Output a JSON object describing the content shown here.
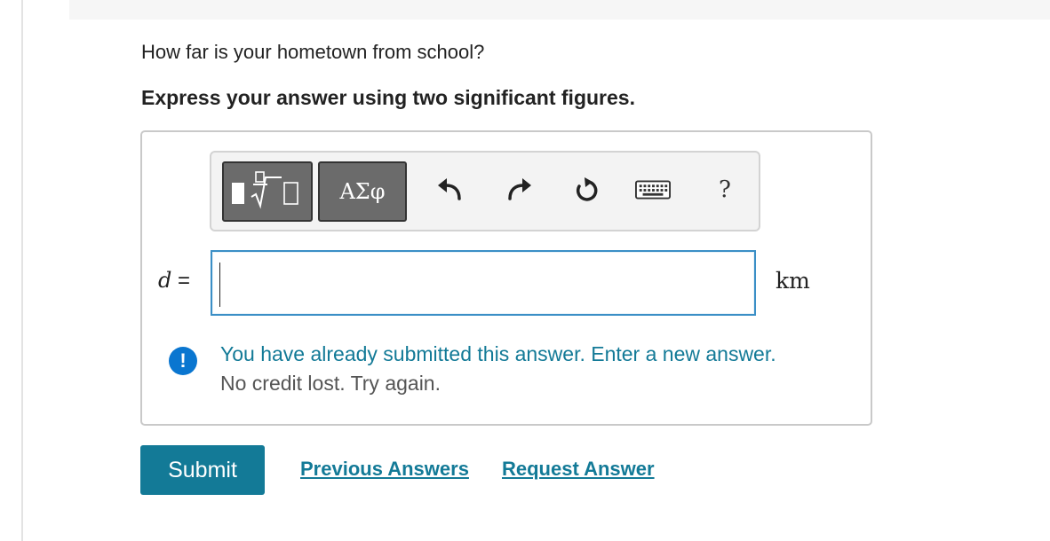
{
  "question": {
    "prompt": "How far is your hometown from school?",
    "instruction": "Express your answer using two significant figures."
  },
  "toolbar": {
    "templates_icon": "fraction-sqrt-templates-icon",
    "symbols_label": "ΑΣφ",
    "undo_icon": "undo-icon",
    "redo_icon": "redo-icon",
    "reset_icon": "reset-icon",
    "keyboard_icon": "keyboard-icon",
    "help_label": "?"
  },
  "answer": {
    "variable": "d",
    "equals": "=",
    "value": "",
    "unit": "km"
  },
  "feedback": {
    "icon": "exclamation-icon",
    "message": "You have already submitted this answer. Enter a new answer.",
    "detail": "No credit lost. Try again."
  },
  "actions": {
    "submit_label": "Submit",
    "previous_answers_label": "Previous Answers",
    "request_answer_label": "Request Answer"
  },
  "colors": {
    "accent": "#137a97",
    "info_icon": "#0a76d0",
    "input_border": "#3b8fc6"
  }
}
